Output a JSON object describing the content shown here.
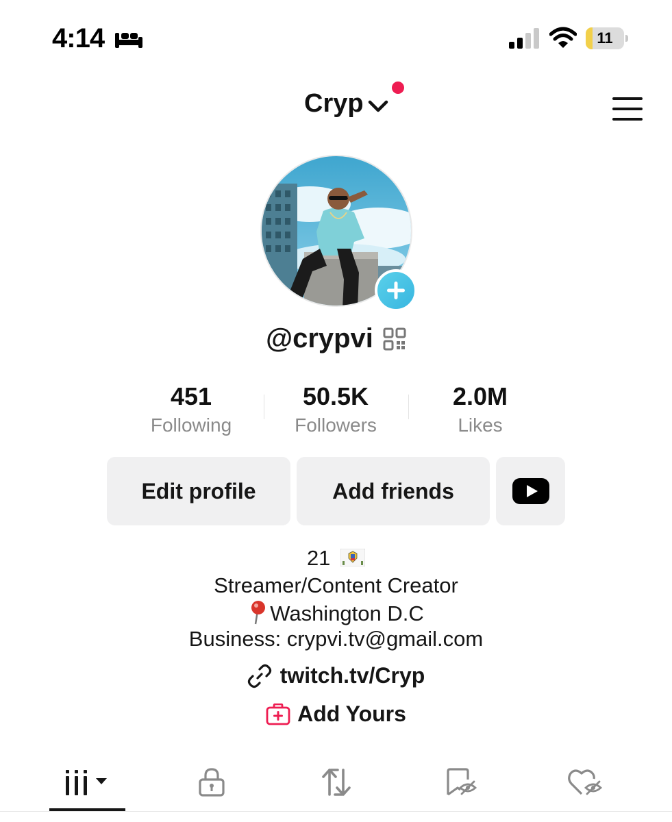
{
  "status_bar": {
    "time": "4:14",
    "focus_icon": "bed-icon",
    "signal_icon": "cellular-signal-icon",
    "wifi_icon": "wifi-icon",
    "battery_level": "11",
    "battery_fraction": 0.11
  },
  "header": {
    "account_name": "Cryp",
    "dropdown_icon": "chevron-down-icon",
    "notification_dot_color": "#ee1d52",
    "menu_icon": "hamburger-menu-icon"
  },
  "profile": {
    "username": "@crypvi",
    "qr_icon": "qr-code-icon",
    "add_avatar_icon": "plus-icon"
  },
  "stats": [
    {
      "value": "451",
      "label": "Following"
    },
    {
      "value": "50.5K",
      "label": "Followers"
    },
    {
      "value": "2.0M",
      "label": "Likes"
    }
  ],
  "actions": {
    "edit_profile": "Edit profile",
    "add_friends": "Add friends",
    "youtube_icon": "youtube-icon"
  },
  "bio": {
    "line1": "21",
    "line1_flag": "us-virgin-islands-flag-icon",
    "line2": "Streamer/Content Creator",
    "line3": "Washington D.C",
    "line3_icon": "round-pushpin-icon",
    "line4": "Business: crypvi.tv@gmail.com"
  },
  "link": {
    "icon": "link-icon",
    "text": "twitch.tv/Cryp"
  },
  "add_yours": {
    "icon": "add-yours-icon",
    "text": "Add Yours",
    "icon_color": "#ee1d52"
  },
  "tabs": [
    {
      "icon": "videos-grid-icon",
      "selected": true
    },
    {
      "icon": "lock-icon",
      "selected": false
    },
    {
      "icon": "repost-icon",
      "selected": false
    },
    {
      "icon": "saved-hidden-icon",
      "selected": false
    },
    {
      "icon": "liked-hidden-icon",
      "selected": false
    }
  ]
}
